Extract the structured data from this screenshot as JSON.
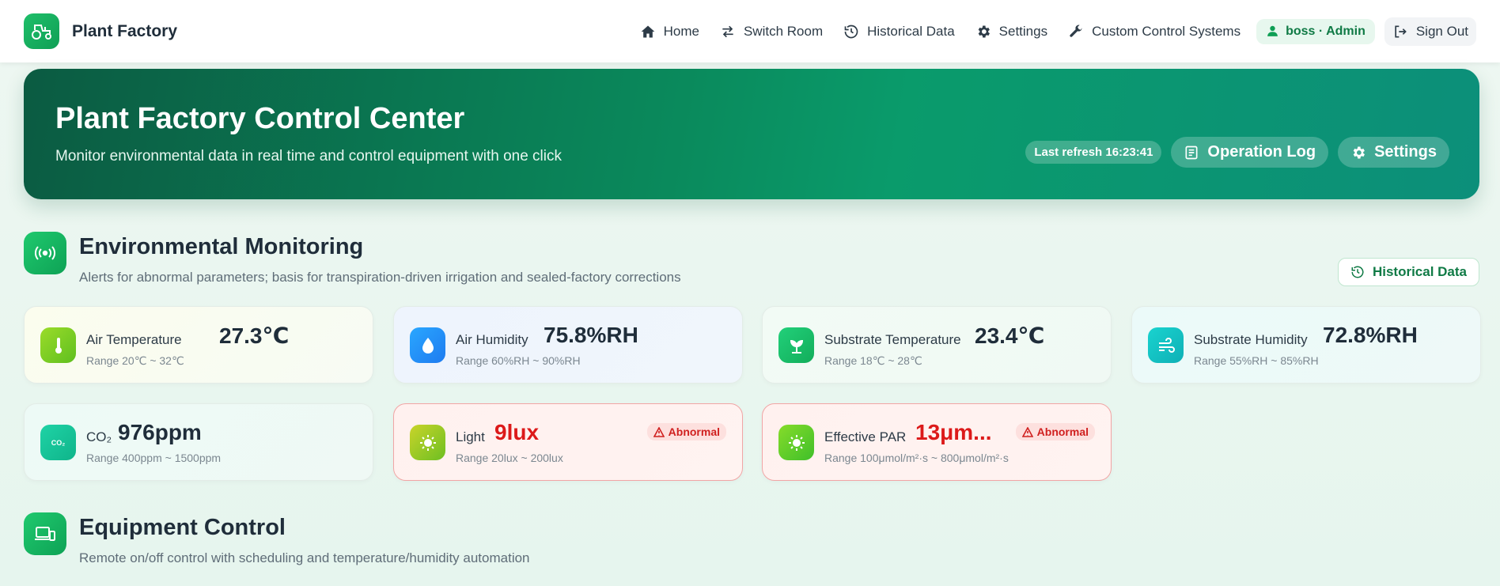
{
  "brand": {
    "title": "Plant Factory"
  },
  "nav": {
    "home": "Home",
    "switch_room": "Switch Room",
    "historical": "Historical Data",
    "settings": "Settings",
    "custom": "Custom Control Systems",
    "user": "boss · Admin",
    "signout": "Sign Out"
  },
  "hero": {
    "title": "Plant Factory Control Center",
    "subtitle": "Monitor environmental data in real time and control equipment with one click",
    "refresh": "Last refresh 16:23:41",
    "log_btn": "Operation Log",
    "settings_btn": "Settings"
  },
  "env": {
    "title": "Environmental Monitoring",
    "desc": "Alerts for abnormal parameters; basis for transpiration-driven irrigation and sealed-factory corrections",
    "hist_btn": "Historical Data"
  },
  "cards": [
    {
      "label": "Air Temperature",
      "value": "27.3℃",
      "range": "Range 20℃ ~ 32℃",
      "icon": "thermometer-icon",
      "color": "#7fcf2a"
    },
    {
      "label": "Air Humidity",
      "value": "75.8%RH",
      "range": "Range 60%RH ~ 90%RH",
      "icon": "droplet-icon",
      "color": "#1e90ff"
    },
    {
      "label": "Substrate Temperature",
      "value": "23.4℃",
      "range": "Range 18℃ ~ 28℃",
      "icon": "sprout-icon",
      "color": "#1ec46a"
    },
    {
      "label": "Substrate Humidity",
      "value": "72.8%RH",
      "range": "Range 55%RH ~ 85%RH",
      "icon": "wind-icon",
      "color": "#12c6c2"
    },
    {
      "label": "CO₂",
      "value": "976ppm",
      "range": "Range 400ppm ~ 1500ppm",
      "icon": "co2-icon",
      "icon_text": "CO₂",
      "color": "#16c39b"
    },
    {
      "label": "Light",
      "value": "9lux",
      "range": "Range 20lux ~ 200lux",
      "icon": "sun-icon",
      "color": "#9bd12a",
      "abnormal": "Abnormal"
    },
    {
      "label": "Effective PAR",
      "value": "13μm...",
      "range": "Range 100μmol/m²·s ~ 800μmol/m²·s",
      "icon": "sun-icon",
      "color": "#6fd12a",
      "abnormal": "Abnormal"
    }
  ],
  "equip": {
    "title": "Equipment Control",
    "desc": "Remote on/off control with scheduling and temperature/humidity automation"
  }
}
